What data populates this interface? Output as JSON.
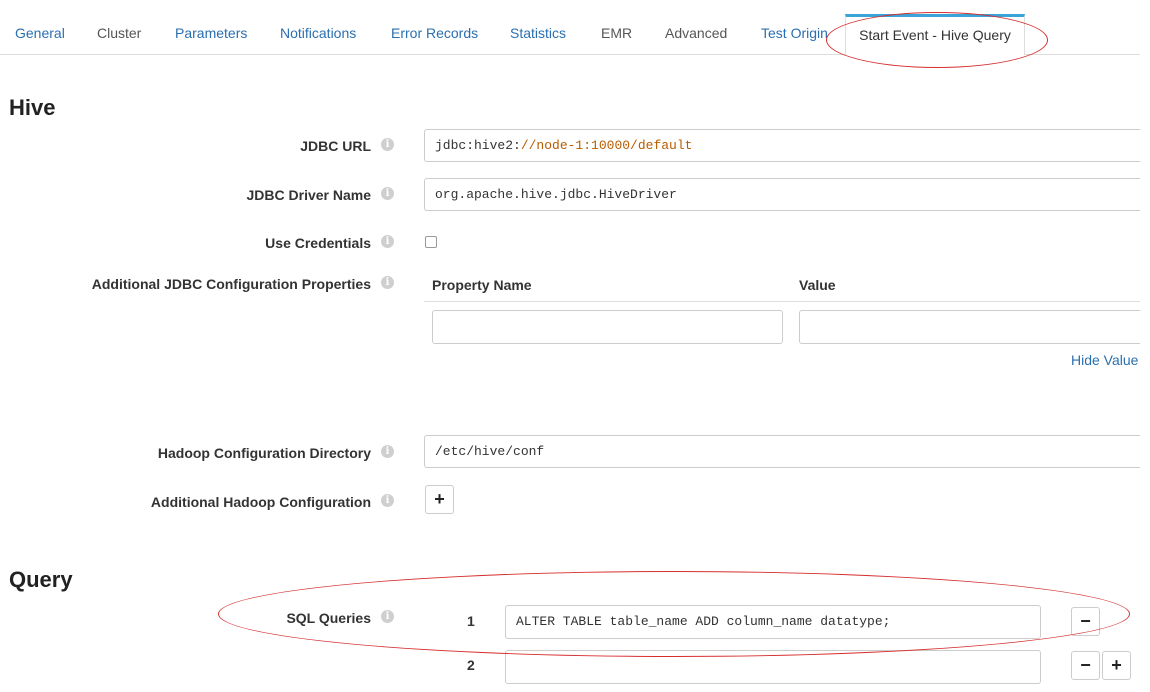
{
  "tabs": [
    {
      "label": "General"
    },
    {
      "label": "Cluster"
    },
    {
      "label": "Parameters"
    },
    {
      "label": "Notifications"
    },
    {
      "label": "Error Records"
    },
    {
      "label": "Statistics"
    },
    {
      "label": "EMR"
    },
    {
      "label": "Advanced"
    },
    {
      "label": "Test Origin"
    },
    {
      "label": "Start Event - Hive Query"
    }
  ],
  "colors": {
    "accent": "#3aa3d8",
    "link": "#2a6fb0",
    "highlight": "#d62e2e"
  },
  "hive": {
    "title": "Hive",
    "jdbc_url": {
      "label": "JDBC URL",
      "scheme": "jdbc:hive2:",
      "host": "//node-1:10000/default"
    },
    "jdbc_driver": {
      "label": "JDBC Driver Name",
      "value": "org.apache.hive.jdbc.HiveDriver"
    },
    "use_credentials": {
      "label": "Use Credentials",
      "checked": false
    },
    "additional_jdbc": {
      "label": "Additional JDBC Configuration Properties",
      "col_name": "Property Name",
      "col_value": "Value",
      "name_value": "",
      "value_value": "",
      "hide_link": "Hide Value"
    },
    "hadoop_dir": {
      "label": "Hadoop Configuration Directory",
      "value": "/etc/hive/conf"
    },
    "additional_hadoop": {
      "label": "Additional Hadoop Configuration",
      "add": "+"
    }
  },
  "query": {
    "title": "Query",
    "sql_label": "SQL Queries",
    "rows": [
      {
        "num": "1",
        "value": "ALTER TABLE table_name ADD column_name datatype;",
        "remove": "−"
      },
      {
        "num": "2",
        "value": "",
        "remove": "−",
        "add": "+"
      }
    ]
  },
  "icons": {
    "info": "info-icon",
    "add": "plus-icon",
    "remove": "minus-icon"
  }
}
